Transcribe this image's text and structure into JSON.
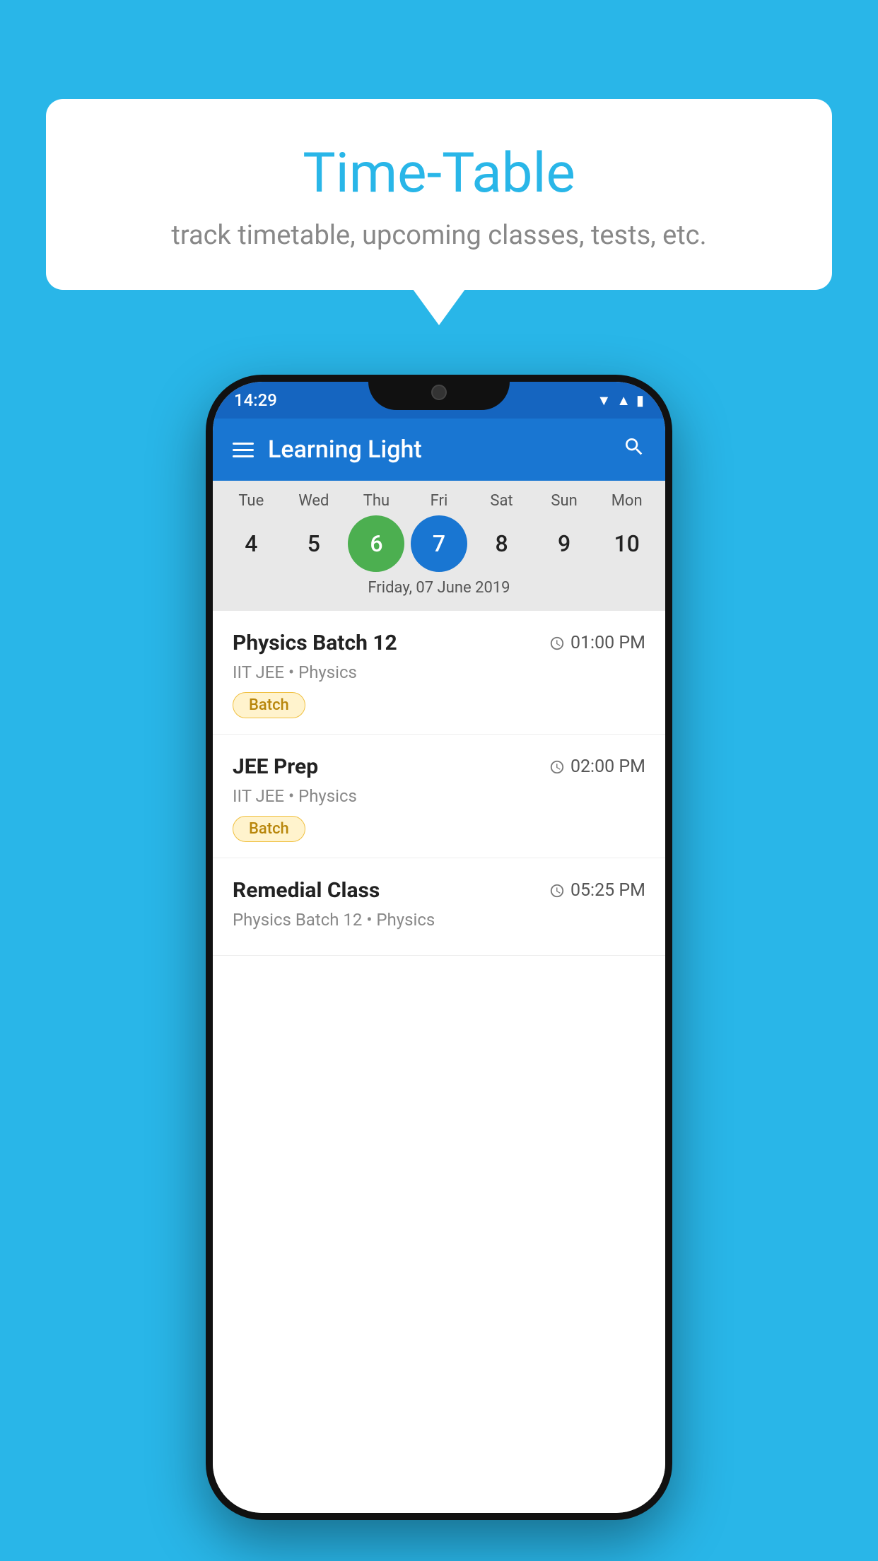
{
  "background_color": "#29B6E8",
  "bubble": {
    "title": "Time-Table",
    "subtitle": "track timetable, upcoming classes, tests, etc."
  },
  "phone": {
    "status_bar": {
      "time": "14:29"
    },
    "app_bar": {
      "title": "Learning Light"
    },
    "calendar": {
      "days": [
        "Tue",
        "Wed",
        "Thu",
        "Fri",
        "Sat",
        "Sun",
        "Mon"
      ],
      "dates": [
        "4",
        "5",
        "6",
        "7",
        "8",
        "9",
        "10"
      ],
      "today_index": 2,
      "selected_index": 3,
      "selected_label": "Friday, 07 June 2019"
    },
    "classes": [
      {
        "name": "Physics Batch 12",
        "time": "01:00 PM",
        "meta": "IIT JEE • Physics",
        "badge": "Batch"
      },
      {
        "name": "JEE Prep",
        "time": "02:00 PM",
        "meta": "IIT JEE • Physics",
        "badge": "Batch"
      },
      {
        "name": "Remedial Class",
        "time": "05:25 PM",
        "meta": "Physics Batch 12 • Physics",
        "badge": null
      }
    ]
  }
}
